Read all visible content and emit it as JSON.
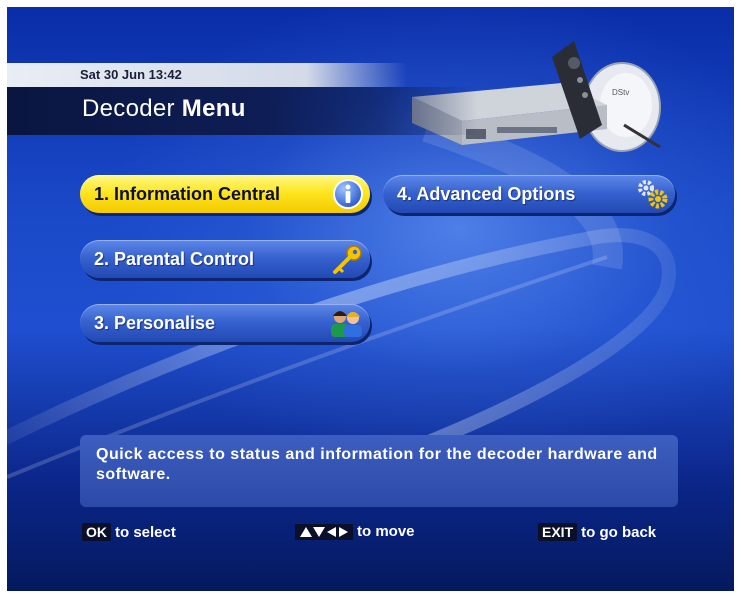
{
  "header": {
    "datetime": "Sat 30 Jun 13:42",
    "title_regular": "Decoder ",
    "title_bold": "Menu"
  },
  "menu": {
    "items": [
      {
        "label": "1. Information Central",
        "icon": "info-icon",
        "selected": true
      },
      {
        "label": "2. Parental Control",
        "icon": "key-icon",
        "selected": false
      },
      {
        "label": "3. Personalise",
        "icon": "people-icon",
        "selected": false
      },
      {
        "label": "4. Advanced Options",
        "icon": "gears-icon",
        "selected": false
      }
    ]
  },
  "description": "Quick access to status and information for the decoder hardware and software.",
  "footer": {
    "ok_key": "OK",
    "ok_label": "to select",
    "move_label": "to move",
    "exit_key": "EXIT",
    "exit_label": "to go back"
  },
  "colors": {
    "selected": "#fde621",
    "button": "#3561cf",
    "background": "#1a49c8"
  }
}
